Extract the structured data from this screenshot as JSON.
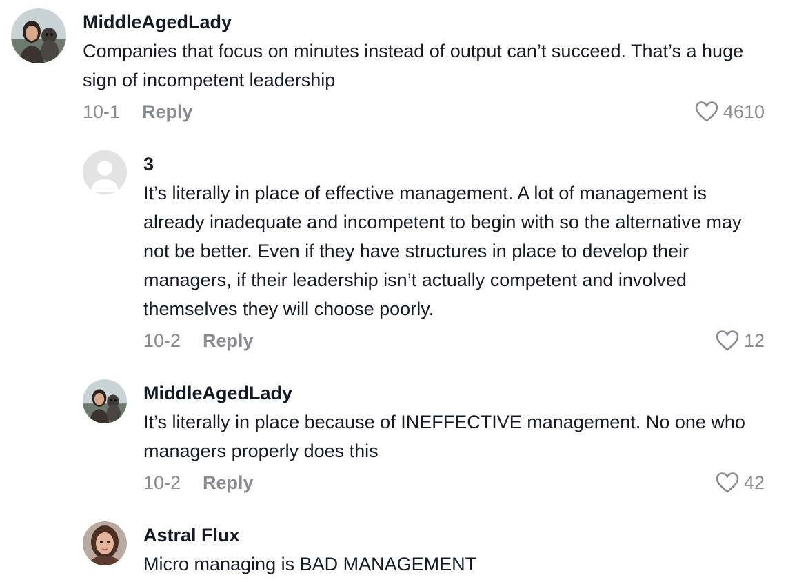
{
  "comments": [
    {
      "username": "MiddleAgedLady",
      "text": "Companies that focus on minutes instead of output can’t succeed. That’s a huge sign of incompetent leadership",
      "date": "10-1",
      "reply_label": "Reply",
      "likes": "4610",
      "avatar": "photo-woman-with-dog"
    },
    {
      "username": "3",
      "text": "It’s literally in place of effective management. A lot of management is already inadequate and incompetent to begin with so the alternative may not be better. Even if they have structures in place to develop their managers, if their leadership isn’t actually competent and involved themselves they will choose poorly.",
      "date": "10-2",
      "reply_label": "Reply",
      "likes": "12",
      "avatar": "default-avatar"
    },
    {
      "username": "MiddleAgedLady",
      "text": "It’s literally in place because of INEFFECTIVE management. No one who managers properly does this",
      "date": "10-2",
      "reply_label": "Reply",
      "likes": "42",
      "avatar": "photo-woman-with-dog"
    },
    {
      "username": "Astral Flux",
      "text": "Micro managing is BAD MANAGEMENT",
      "avatar": "photo-woman-portrait"
    }
  ],
  "colors": {
    "text": "#161823",
    "muted": "#8a8b91",
    "default_avatar_bg": "#e3e3e4"
  }
}
